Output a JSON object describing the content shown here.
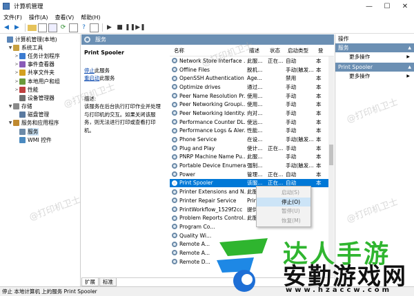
{
  "window": {
    "title": "计算机管理"
  },
  "menu": [
    "文件(F)",
    "操作(A)",
    "查看(V)",
    "帮助(H)"
  ],
  "tree": [
    {
      "label": "计算机管理(本地)",
      "level": 0,
      "arrow": ""
    },
    {
      "label": "系统工具",
      "level": 1,
      "arrow": "▼"
    },
    {
      "label": "任务计划程序",
      "level": 2,
      "arrow": ">"
    },
    {
      "label": "事件查看器",
      "level": 2,
      "arrow": ">"
    },
    {
      "label": "共享文件夹",
      "level": 2,
      "arrow": ">"
    },
    {
      "label": "本地用户和组",
      "level": 2,
      "arrow": ">"
    },
    {
      "label": "性能",
      "level": 2,
      "arrow": ">"
    },
    {
      "label": "设备管理器",
      "level": 2,
      "arrow": ""
    },
    {
      "label": "存储",
      "level": 1,
      "arrow": "▼"
    },
    {
      "label": "磁盘管理",
      "level": 2,
      "arrow": ""
    },
    {
      "label": "服务和应用程序",
      "level": 1,
      "arrow": "▼"
    },
    {
      "label": "服务",
      "level": 2,
      "arrow": "",
      "selected": true
    },
    {
      "label": "WMI 控件",
      "level": 2,
      "arrow": ""
    }
  ],
  "panel": {
    "title": "服务"
  },
  "description": {
    "service_name": "Print Spooler",
    "stop_link": "停止",
    "stop_suffix": "此服务",
    "restart_link": "重启动",
    "restart_suffix": "此服务",
    "desc_label": "描述:",
    "desc_text": "该服务在后台执行打印作业并处理与打印机的交互。如果关闭该服务，则无法进行打印或查看打印机。"
  },
  "columns": {
    "name": "名称",
    "desc": "描述",
    "status": "状态",
    "startup": "启动类型",
    "logon": "登"
  },
  "services": [
    {
      "name": "Network Store Interface ...",
      "desc": "此服...",
      "status": "正在...",
      "startup": "自动",
      "logon": "本"
    },
    {
      "name": "Offline Files",
      "desc": "脱机...",
      "status": "",
      "startup": "手动(触发...",
      "logon": "本"
    },
    {
      "name": "OpenSSH Authentication ...",
      "desc": "Age...",
      "status": "",
      "startup": "禁用",
      "logon": "本"
    },
    {
      "name": "Optimize drives",
      "desc": "通过...",
      "status": "",
      "startup": "手动",
      "logon": "本"
    },
    {
      "name": "Peer Name Resolution Pr...",
      "desc": "使用...",
      "status": "",
      "startup": "手动",
      "logon": "本"
    },
    {
      "name": "Peer Networking Groupi...",
      "desc": "使用...",
      "status": "",
      "startup": "手动",
      "logon": "本"
    },
    {
      "name": "Peer Networking Identity...",
      "desc": "向对...",
      "status": "",
      "startup": "手动",
      "logon": "本"
    },
    {
      "name": "Performance Counter DL...",
      "desc": "使远...",
      "status": "",
      "startup": "手动",
      "logon": "本"
    },
    {
      "name": "Performance Logs & Aler...",
      "desc": "性能...",
      "status": "",
      "startup": "手动",
      "logon": "本"
    },
    {
      "name": "Phone Service",
      "desc": "在设...",
      "status": "",
      "startup": "手动(触发...",
      "logon": "本"
    },
    {
      "name": "Plug and Play",
      "desc": "使计...",
      "status": "正在...",
      "startup": "手动",
      "logon": "本"
    },
    {
      "name": "PNRP Machine Name Pu...",
      "desc": "此服...",
      "status": "",
      "startup": "手动",
      "logon": "本"
    },
    {
      "name": "Portable Device Enumera...",
      "desc": "强制...",
      "status": "",
      "startup": "手动(触发...",
      "logon": "本"
    },
    {
      "name": "Power",
      "desc": "管理...",
      "status": "正在...",
      "startup": "自动",
      "logon": "本"
    },
    {
      "name": "Print Spooler",
      "desc": "该服...",
      "status": "正在...",
      "startup": "自动",
      "logon": "本",
      "selected": true
    },
    {
      "name": "Printer Extensions and N...",
      "desc": "此服...",
      "status": "",
      "startup": "",
      "logon": ""
    },
    {
      "name": "Printer Repair Service",
      "desc": "Prin...",
      "status": "",
      "startup": "",
      "logon": ""
    },
    {
      "name": "PrintWorkflow_1529f2cc",
      "desc": "提供...",
      "status": "",
      "startup": "",
      "logon": ""
    },
    {
      "name": "Problem Reports Control...",
      "desc": "此服...",
      "status": "",
      "startup": "",
      "logon": ""
    },
    {
      "name": "Program Co...",
      "desc": "",
      "status": "",
      "startup": "",
      "logon": ""
    },
    {
      "name": "Quality Wi...",
      "desc": "",
      "status": "",
      "startup": "",
      "logon": ""
    },
    {
      "name": "Remote A...",
      "desc": "",
      "status": "",
      "startup": "",
      "logon": ""
    },
    {
      "name": "Remote A...",
      "desc": "",
      "status": "",
      "startup": "",
      "logon": ""
    },
    {
      "name": "Remote D...",
      "desc": "",
      "status": "",
      "startup": "",
      "logon": ""
    }
  ],
  "context_menu": [
    {
      "label": "启动(S)",
      "disabled": true
    },
    {
      "label": "停止(O)",
      "highlighted": true
    },
    {
      "label": "暂停(U)",
      "disabled": true
    },
    {
      "label": "恢复(M)",
      "disabled": true
    }
  ],
  "tabs": [
    "扩展",
    "标准"
  ],
  "actions": {
    "title": "操作",
    "groups": [
      {
        "header": "服务",
        "item": "更多操作"
      },
      {
        "header": "Print Spooler",
        "item": "更多操作"
      }
    ]
  },
  "statusbar": {
    "text": "停止 本地计算机 上的服务 Print Spooler"
  },
  "watermark": "@打印机卫士",
  "logo": {
    "line1": "达人手游",
    "line2": "安勤游戏网",
    "url": "www.hzaccw.com"
  },
  "colors": {
    "header": "#6b8fb3",
    "selection": "#0078d7",
    "logo_green": "#2fb52f"
  }
}
